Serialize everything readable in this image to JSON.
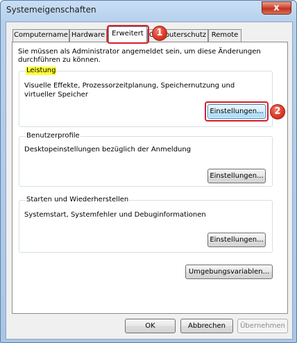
{
  "window": {
    "title": "Systemeigenschaften",
    "close_glyph": "x"
  },
  "tabs": [
    {
      "label": "Computername"
    },
    {
      "label": "Hardware"
    },
    {
      "label": "Erweitert"
    },
    {
      "label": "Computerschutz"
    },
    {
      "label": "Remote"
    }
  ],
  "intro_text": "Sie müssen als Administrator angemeldet sein, um diese Änderungen durchführen zu können.",
  "performance": {
    "label": "Leistung",
    "description": "Visuelle Effekte, Prozessorzeitplanung, Speichernutzung und virtueller Speicher",
    "button": "Einstellungen..."
  },
  "profiles": {
    "label": "Benutzerprofile",
    "description": "Desktopeinstellungen bezüglich der Anmeldung",
    "button": "Einstellungen..."
  },
  "startup": {
    "label": "Starten und Wiederherstellen",
    "description": "Systemstart, Systemfehler und Debuginformationen",
    "button": "Einstellungen..."
  },
  "env_button": "Umgebungsvariablen...",
  "footer": {
    "ok": "OK",
    "cancel": "Abbrechen",
    "apply": "Übernehmen"
  },
  "annotations": {
    "callout_1": "1",
    "callout_2": "2",
    "color": "#d3202a",
    "highlight_color": "#ffff33"
  }
}
